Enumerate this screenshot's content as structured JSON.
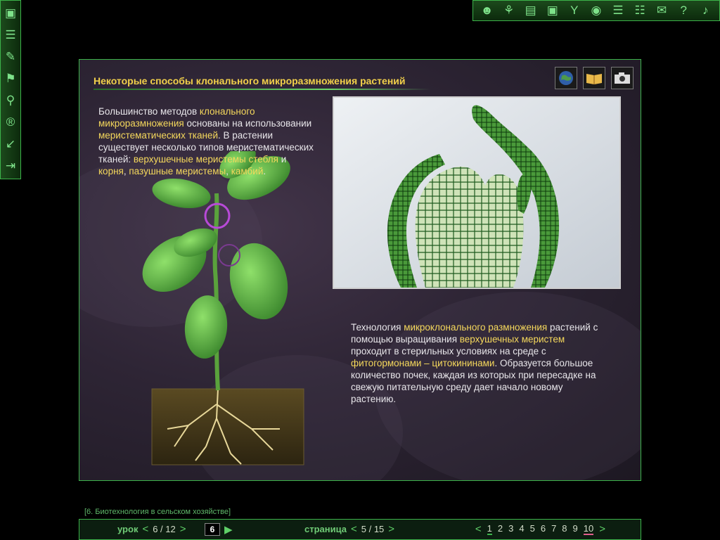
{
  "topbar": {
    "icons": [
      "people-icon",
      "tree-icon",
      "book-icon",
      "folder-icon",
      "network-icon",
      "globe-icon",
      "stack-icon",
      "document-icon",
      "chat-icon",
      "help-icon",
      "sound-icon"
    ]
  },
  "sidebar": {
    "icons": [
      "monitor-icon",
      "pages-icon",
      "edit-icon",
      "bookmark-icon",
      "search-icon",
      "registered-icon",
      "resize-icon",
      "exit-icon"
    ]
  },
  "slide": {
    "title": "Некоторые способы клонального микроразмножения растений",
    "text1": [
      {
        "t": "Большинство методов ",
        "hl": false
      },
      {
        "t": "клонального микроразмножения",
        "hl": true
      },
      {
        "t": " основаны на использовании ",
        "hl": false
      },
      {
        "t": "меристематических тканей",
        "hl": true
      },
      {
        "t": ". В растении существует несколько типов меристематических тканей: ",
        "hl": false
      },
      {
        "t": "верхушечные меристемы стебля",
        "hl": true
      },
      {
        "t": " и ",
        "hl": false
      },
      {
        "t": "корня",
        "hl": true
      },
      {
        "t": ", ",
        "hl": false
      },
      {
        "t": "пазушные меристемы",
        "hl": true
      },
      {
        "t": ", ",
        "hl": false
      },
      {
        "t": "камбий",
        "hl": true
      },
      {
        "t": ".",
        "hl": false
      }
    ],
    "text2": [
      {
        "t": "Технология ",
        "hl": false
      },
      {
        "t": "микроклонального размножения",
        "hl": true
      },
      {
        "t": " растений с помощью выращивания ",
        "hl": false
      },
      {
        "t": "верхушечных меристем",
        "hl": true
      },
      {
        "t": " проходит в стерильных условиях на среде с ",
        "hl": false
      },
      {
        "t": "фитогормонами – цитокининами",
        "hl": true
      },
      {
        "t": ". Образуется большое количество почек, каждая из которых при пересадке на свежую питательную среду дает начало новому растению.",
        "hl": false
      }
    ]
  },
  "footer": {
    "breadcrumb": "[6. Биотехнология в сельском хозяйстве]",
    "lesson_label": "урок",
    "lesson_value": "6 / 12",
    "goto_value": "6",
    "page_label": "страница",
    "page_value": "5 / 15",
    "pages": [
      "1",
      "2",
      "3",
      "4",
      "5",
      "6",
      "7",
      "8",
      "9",
      "10"
    ]
  },
  "colors": {
    "accent": "#3cb34a",
    "highlight": "#f5d85c",
    "text": "#e8e6ea"
  }
}
